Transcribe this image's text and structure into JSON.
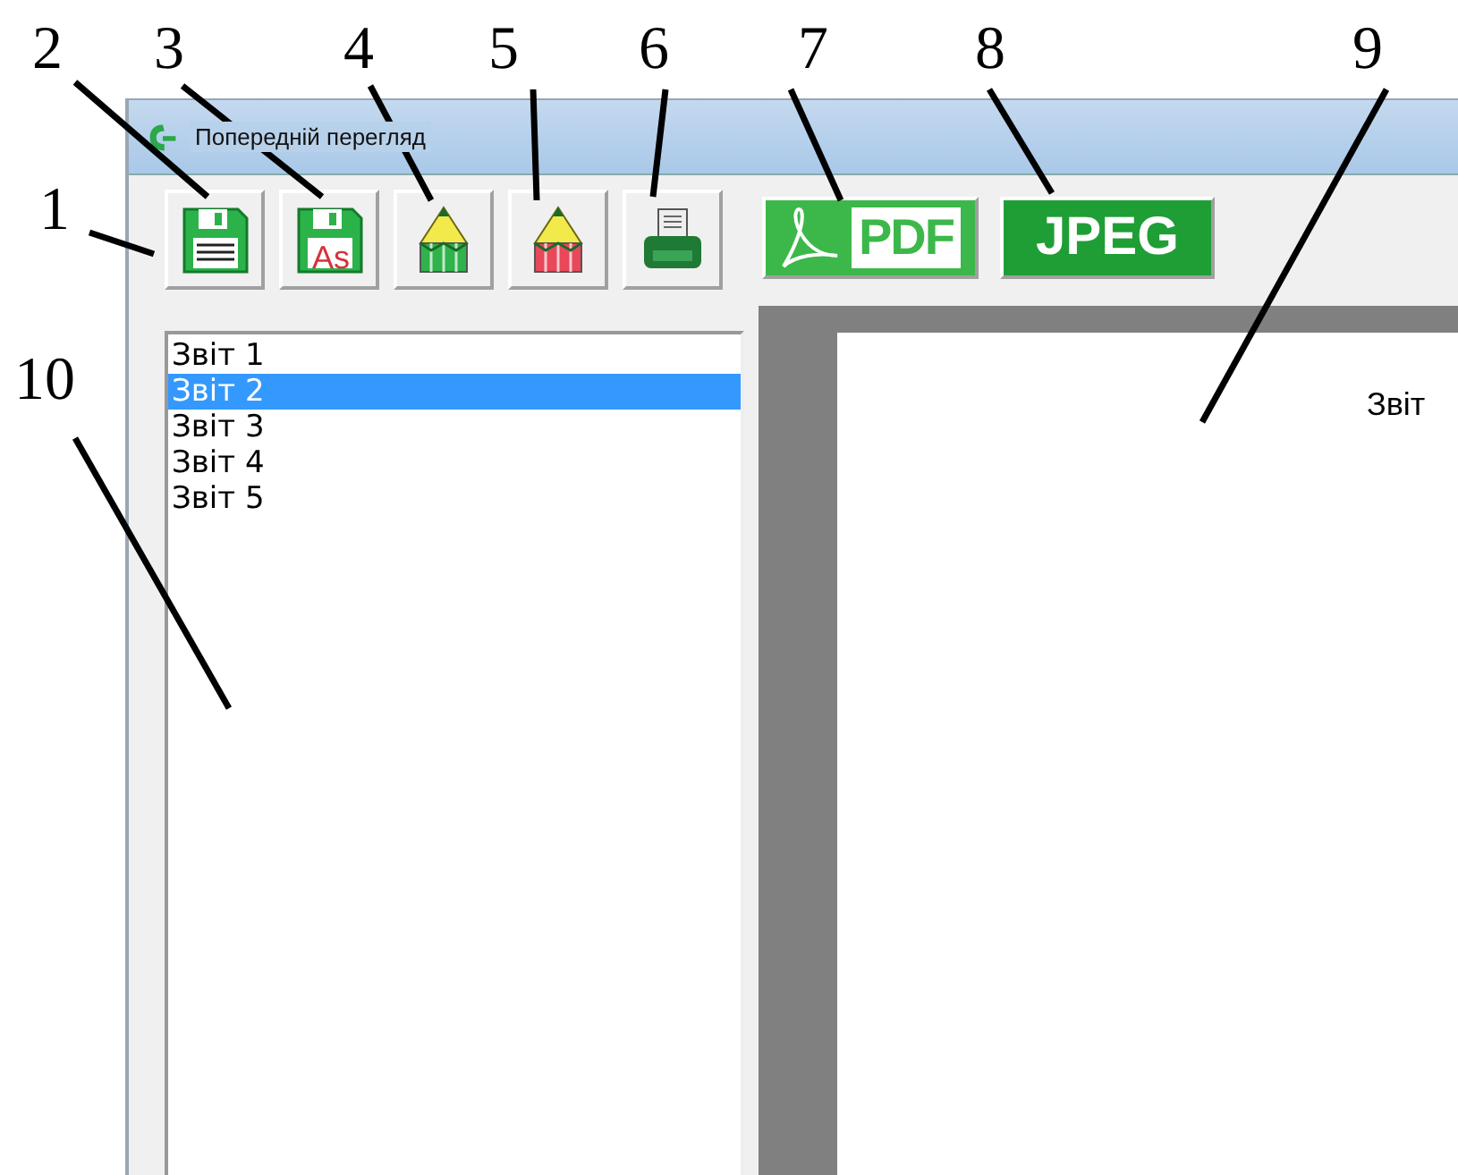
{
  "window": {
    "title": "Попередній перегляд"
  },
  "toolbar": [
    {
      "kind": "save"
    },
    {
      "kind": "save_as",
      "text": "As"
    },
    {
      "kind": "edit"
    },
    {
      "kind": "edit_color"
    },
    {
      "kind": "print"
    },
    {
      "kind": "pdf",
      "text": "PDF"
    },
    {
      "kind": "jpeg",
      "text": "JPEG"
    }
  ],
  "reports": [
    {
      "label": "Звіт 1",
      "selected": false
    },
    {
      "label": "Звіт 2",
      "selected": true
    },
    {
      "label": "Звіт 3",
      "selected": false
    },
    {
      "label": "Звіт 4",
      "selected": false
    },
    {
      "label": "Звіт 5",
      "selected": false
    }
  ],
  "preview": {
    "heading": "Звіт"
  },
  "callouts": [
    {
      "label": "2"
    },
    {
      "label": "3"
    },
    {
      "label": "4"
    },
    {
      "label": "5"
    },
    {
      "label": "6"
    },
    {
      "label": "7"
    },
    {
      "label": "8"
    },
    {
      "label": "9"
    },
    {
      "label": "1"
    },
    {
      "label": "10"
    }
  ]
}
